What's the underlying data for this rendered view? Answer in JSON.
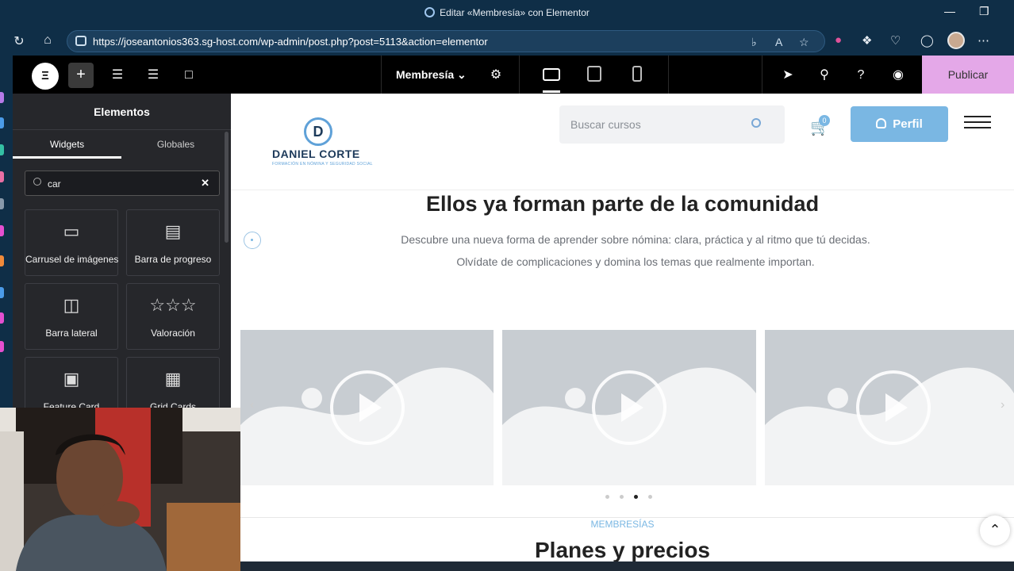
{
  "browser": {
    "window_title": "Editar «Membresía» con Elementor",
    "url": "https://joseantonios363.sg-host.com/wp-admin/post.php?post=5113&action=elementor"
  },
  "editor": {
    "page_name": "Membresía",
    "publish_label": "Publicar"
  },
  "sidebar": {
    "title": "Elementos",
    "tabs": [
      "Widgets",
      "Globales"
    ],
    "search_value": "car",
    "widgets": [
      {
        "label": "Carrusel de imágenes",
        "icon": "carousel-icon"
      },
      {
        "label": "Barra de progreso",
        "icon": "progress-bar-icon"
      },
      {
        "label": "Barra lateral",
        "icon": "sidebar-icon"
      },
      {
        "label": "Valoración",
        "icon": "rating-stars-icon"
      },
      {
        "label": "Feature Card",
        "icon": "feature-card-icon"
      },
      {
        "label": "Grid Cards",
        "icon": "grid-cards-icon"
      }
    ]
  },
  "site": {
    "logo_letter": "D",
    "logo_name": "DANIEL CORTE",
    "logo_sub": "FORMACIÓN EN NÓMINA Y SEGURIDAD SOCIAL",
    "search_placeholder": "Buscar cursos",
    "cart_count": "0",
    "profile_label": "Perfil",
    "section_title": "Ellos ya forman parte de la comunidad",
    "section_desc": "Descubre una nueva forma de aprender sobre nómina: clara, práctica y al ritmo que tú decidas. Olvídate de complicaciones y domina los temas que realmente importan.",
    "tagline": "MEMBRESÍAS",
    "plans_title": "Planes y precios",
    "carousel": {
      "slide_count": 3,
      "dot_count": 4,
      "active_dot": 3
    }
  },
  "colors": {
    "accent": "#7ab7e3",
    "publish": "#e4a8e8",
    "browser_chrome": "#0f2e47",
    "editor_bar": "#000000",
    "panel": "#26272b"
  }
}
